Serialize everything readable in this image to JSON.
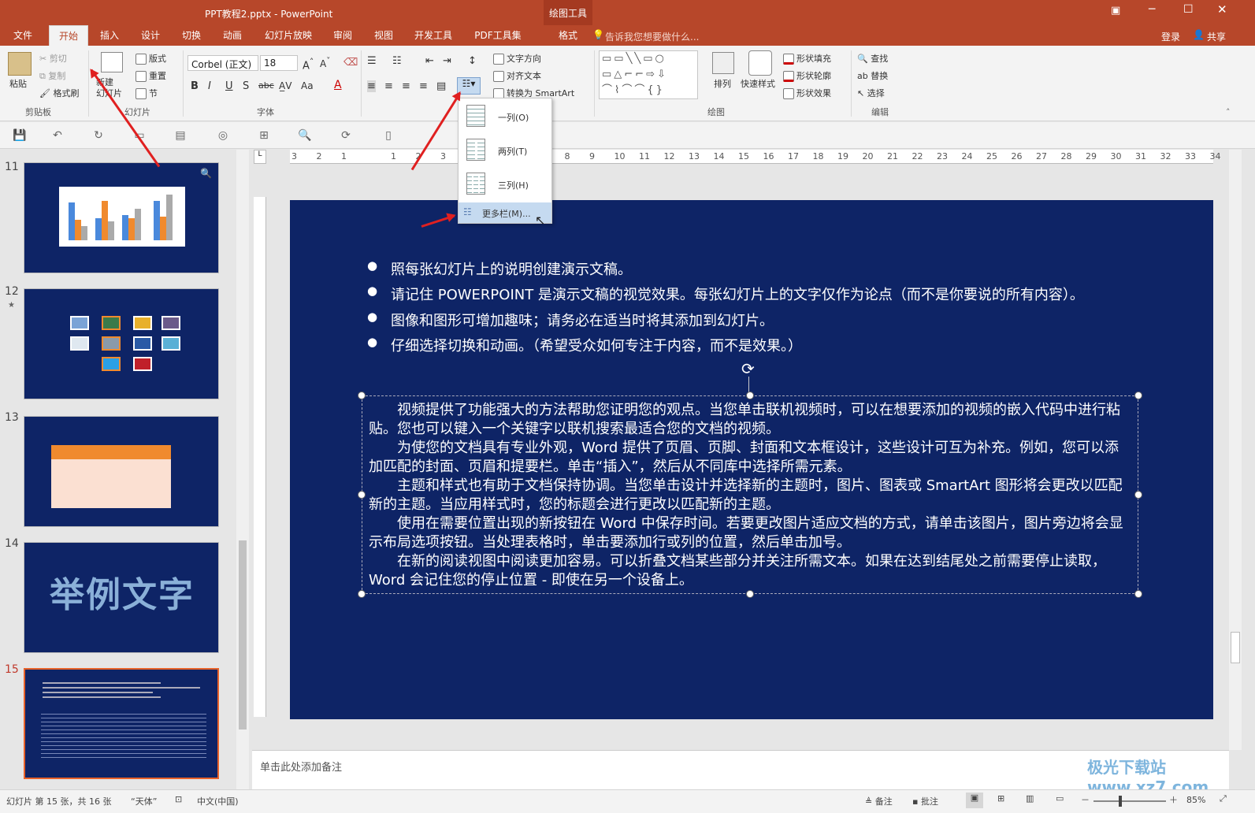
{
  "window": {
    "title": "PPT教程2.pptx - PowerPoint",
    "drawing_tools": "绘图工具",
    "login": "登录",
    "share": "共享"
  },
  "tabs": [
    "文件",
    "开始",
    "插入",
    "设计",
    "切换",
    "动画",
    "幻灯片放映",
    "审阅",
    "视图",
    "开发工具",
    "PDF工具集",
    "格式"
  ],
  "tell_me": "告诉我您想要做什么...",
  "ribbon": {
    "clipboard": {
      "paste": "粘贴",
      "cut": "剪切",
      "copy": "复制",
      "format_painter": "格式刷",
      "group": "剪贴板"
    },
    "slides": {
      "new_slide": "新建\n幻灯片",
      "layout": "版式",
      "reset": "重置",
      "section": "节",
      "group": "幻灯片"
    },
    "font": {
      "font_name": "Corbel (正文)",
      "font_size": "18",
      "group": "字体"
    },
    "paragraph": {
      "text_direction": "文字方向",
      "align_text": "对齐文本",
      "convert_smartart": "转换为 SmartArt"
    },
    "drawing": {
      "arrange": "排列",
      "quick_styles": "快速样式",
      "shape_fill": "形状填充",
      "shape_outline": "形状轮廓",
      "shape_effects": "形状效果",
      "group": "绘图"
    },
    "editing": {
      "find": "查找",
      "replace": "替换",
      "select": "选择",
      "group": "编辑"
    }
  },
  "columns_menu": {
    "one": "一列(O)",
    "two": "两列(T)",
    "three": "三列(H)",
    "more": "更多栏(M)..."
  },
  "ruler_ticks": [
    "3",
    "2",
    "1",
    "",
    "1",
    "2",
    "3",
    "",
    "",
    "",
    "",
    "8",
    "9",
    "10",
    "11",
    "12",
    "13",
    "14",
    "15",
    "16",
    "17",
    "18",
    "19",
    "20",
    "21",
    "22",
    "23",
    "24",
    "25",
    "26",
    "27",
    "28",
    "29",
    "30",
    "31",
    "32",
    "33",
    "34"
  ],
  "slide_thumbs": [
    {
      "num": "11"
    },
    {
      "num": "12"
    },
    {
      "num": "13"
    },
    {
      "num": "14",
      "text": "举例文字"
    },
    {
      "num": "15"
    }
  ],
  "slide": {
    "bullets": [
      "照每张幻灯片上的说明创建演示文稿。",
      "请记住 POWERPOINT 是演示文稿的视觉效果。每张幻灯片上的文字仅作为论点（而不是你要说的所有内容）。",
      "图像和图形可增加趣味；请务必在适当时将其添加到幻灯片。",
      "仔细选择切换和动画。（希望受众如何专注于内容，而不是效果。）"
    ],
    "paragraphs": [
      "视频提供了功能强大的方法帮助您证明您的观点。当您单击联机视频时，可以在想要添加的视频的嵌入代码中进行粘贴。您也可以键入一个关键字以联机搜索最适合您的文档的视频。",
      "为使您的文档具有专业外观，Word 提供了页眉、页脚、封面和文本框设计，这些设计可互为补充。例如，您可以添加匹配的封面、页眉和提要栏。单击“插入”，然后从不同库中选择所需元素。",
      "主题和样式也有助于文档保持协调。当您单击设计并选择新的主题时，图片、图表或 SmartArt 图形将会更改以匹配新的主题。当应用样式时，您的标题会进行更改以匹配新的主题。",
      "使用在需要位置出现的新按钮在 Word 中保存时间。若要更改图片适应文档的方式，请单击该图片，图片旁边将会显示布局选项按钮。当处理表格时，单击要添加行或列的位置，然后单击加号。",
      "在新的阅读视图中阅读更加容易。可以折叠文档某些部分并关注所需文本。如果在达到结尾处之前需要停止读取，Word 会记住您的停止位置 - 即使在另一个设备上。"
    ]
  },
  "notes_placeholder": "单击此处添加备注",
  "status": {
    "slide_info": "幻灯片 第 15 张，共 16 张",
    "theme": "“天体”",
    "language": "中文(中国)",
    "notes": "备注",
    "comments": "批注",
    "zoom": "85%"
  },
  "colors": {
    "accent": "#b7472a",
    "slide_bg": "#0e2466",
    "annotation": "#e02020"
  },
  "watermark": "极光下载站 www.xz7.com"
}
